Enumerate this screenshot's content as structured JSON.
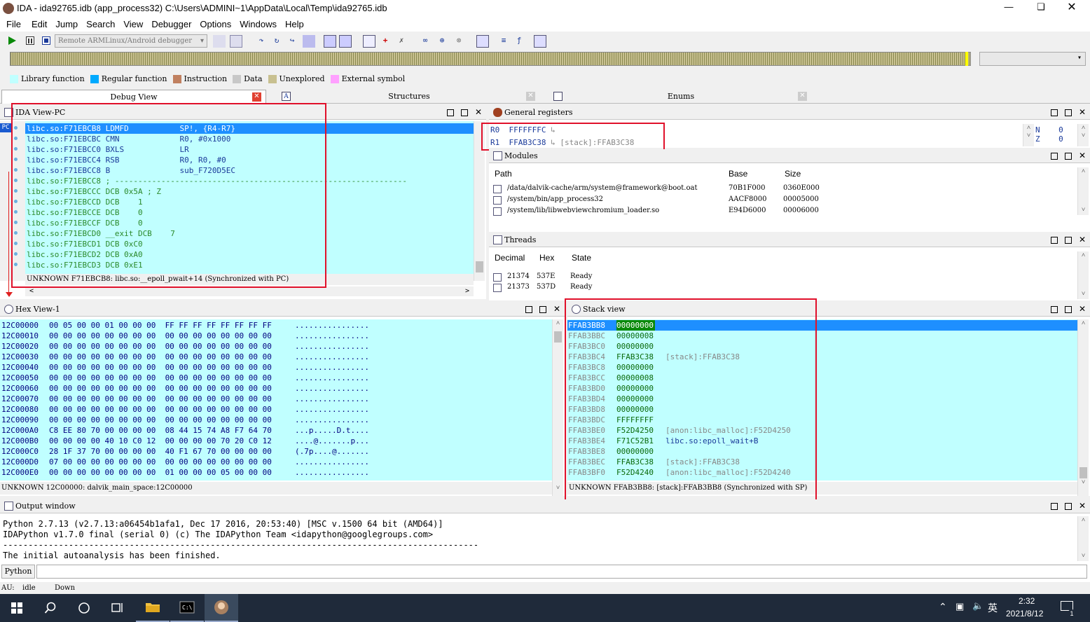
{
  "window": {
    "title": "IDA - ida92765.idb (app_process32) C:\\Users\\ADMINI~1\\AppData\\Local\\Temp\\ida92765.idb"
  },
  "menu": [
    "File",
    "Edit",
    "Jump",
    "Search",
    "View",
    "Debugger",
    "Options",
    "Windows",
    "Help"
  ],
  "toolbar": {
    "debugger_select": "Remote ARMLinux/Android debugger"
  },
  "legend": [
    {
      "label": "Library function",
      "color": "#c0ffff"
    },
    {
      "label": "Regular function",
      "color": "#00aaff"
    },
    {
      "label": "Instruction",
      "color": "#c08060"
    },
    {
      "label": "Data",
      "color": "#c8c8c8"
    },
    {
      "label": "Unexplored",
      "color": "#c8c090"
    },
    {
      "label": "External symbol",
      "color": "#ffa0ff"
    }
  ],
  "tabs": {
    "debug_view": "Debug View",
    "structures": "Structures",
    "enums": "Enums"
  },
  "ida_view": {
    "title": "IDA View-PC",
    "pc_label": "PC",
    "lines": [
      "libc.so:F71EBCB8 LDMFD           SP!, {R4-R7}",
      "libc.so:F71EBCBC CMN             R0, #0x1000",
      "libc.so:F71EBCC0 BXLS            LR",
      "libc.so:F71EBCC4 RSB             R0, R0, #0",
      "libc.so:F71EBCC8 B               sub_F720D5EC",
      "libc.so:F71EBCC8 ; ---------------------------------------------------------------",
      "libc.so:F71EBCCC DCB 0x5A ; Z",
      "libc.so:F71EBCCD DCB    1",
      "libc.so:F71EBCCE DCB    0",
      "libc.so:F71EBCCF DCB    0",
      "libc.so:F71EBCD0 __exit DCB    7",
      "libc.so:F71EBCD1 DCB 0xC0",
      "libc.so:F71EBCD2 DCB 0xA0",
      "libc.so:F71EBCD3 DCB 0xE1"
    ],
    "status": "UNKNOWN F71EBCB8: libc.so:__epoll_pwait+14 (Synchronized with PC)"
  },
  "registers": {
    "title": "General registers",
    "rows": [
      {
        "name": "R0",
        "value": "FFFFFFFC",
        "note": ""
      },
      {
        "name": "R1",
        "value": "FFAB3C38",
        "note": "[stack]:FFAB3C38"
      }
    ],
    "flags": [
      {
        "name": "N",
        "value": "0"
      },
      {
        "name": "Z",
        "value": "0"
      }
    ]
  },
  "modules": {
    "title": "Modules",
    "headers": [
      "Path",
      "Base",
      "Size"
    ],
    "rows": [
      [
        "/data/dalvik-cache/arm/system@framework@boot.oat",
        "70B1F000",
        "0360E000"
      ],
      [
        "/system/bin/app_process32",
        "AACF8000",
        "00005000"
      ],
      [
        "/system/lib/libwebviewchromium_loader.so",
        "E94D6000",
        "00006000"
      ]
    ]
  },
  "threads": {
    "title": "Threads",
    "headers": [
      "Decimal",
      "Hex",
      "State"
    ],
    "rows": [
      [
        "21374",
        "537E",
        "Ready"
      ],
      [
        "21373",
        "537D",
        "Ready"
      ]
    ]
  },
  "hex_view": {
    "title": "Hex View-1",
    "rows": [
      [
        "12C00000",
        "00 05 00 00 01 00 00 00  FF FF FF FF FF FF FF FF",
        "................"
      ],
      [
        "12C00010",
        "00 00 00 00 00 00 00 00  00 00 00 00 00 00 00 00",
        "................"
      ],
      [
        "12C00020",
        "00 00 00 00 00 00 00 00  00 00 00 00 00 00 00 00",
        "................"
      ],
      [
        "12C00030",
        "00 00 00 00 00 00 00 00  00 00 00 00 00 00 00 00",
        "................"
      ],
      [
        "12C00040",
        "00 00 00 00 00 00 00 00  00 00 00 00 00 00 00 00",
        "................"
      ],
      [
        "12C00050",
        "00 00 00 00 00 00 00 00  00 00 00 00 00 00 00 00",
        "................"
      ],
      [
        "12C00060",
        "00 00 00 00 00 00 00 00  00 00 00 00 00 00 00 00",
        "................"
      ],
      [
        "12C00070",
        "00 00 00 00 00 00 00 00  00 00 00 00 00 00 00 00",
        "................"
      ],
      [
        "12C00080",
        "00 00 00 00 00 00 00 00  00 00 00 00 00 00 00 00",
        "................"
      ],
      [
        "12C00090",
        "00 00 00 00 00 00 00 00  00 00 00 00 00 00 00 00",
        "................"
      ],
      [
        "12C000A0",
        "C8 EE 80 70 00 00 00 00  08 44 15 74 A8 F7 64 70",
        "...p.....D.t...."
      ],
      [
        "12C000B0",
        "00 00 00 00 40 10 C0 12  00 00 00 00 70 20 C0 12",
        "....@.......p..."
      ],
      [
        "12C000C0",
        "28 1F 37 70 00 00 00 00  40 F1 67 70 00 00 00 00",
        "(.7p....@......."
      ],
      [
        "12C000D0",
        "07 00 00 00 00 00 00 00  00 00 00 00 00 00 00 00",
        "................"
      ],
      [
        "12C000E0",
        "00 00 00 00 00 00 00 00  01 00 00 00 05 00 00 00",
        "................"
      ]
    ],
    "status": "UNKNOWN 12C00000: dalvik_main_space:12C00000"
  },
  "stack_view": {
    "title": "Stack view",
    "rows": [
      [
        "FFAB3BB8",
        "00000000",
        ""
      ],
      [
        "FFAB3BBC",
        "00000008",
        ""
      ],
      [
        "FFAB3BC0",
        "00000000",
        ""
      ],
      [
        "FFAB3BC4",
        "FFAB3C38",
        "[stack]:FFAB3C38"
      ],
      [
        "FFAB3BC8",
        "00000000",
        ""
      ],
      [
        "FFAB3BCC",
        "00000008",
        ""
      ],
      [
        "FFAB3BD0",
        "00000000",
        ""
      ],
      [
        "FFAB3BD4",
        "00000000",
        ""
      ],
      [
        "FFAB3BD8",
        "00000000",
        ""
      ],
      [
        "FFAB3BDC",
        "FFFFFFFF",
        ""
      ],
      [
        "FFAB3BE0",
        "F52D4250",
        "[anon:libc_malloc]:F52D4250"
      ],
      [
        "FFAB3BE4",
        "F71C52B1",
        "libc.so:epoll_wait+B"
      ],
      [
        "FFAB3BE8",
        "00000000",
        ""
      ],
      [
        "FFAB3BEC",
        "FFAB3C38",
        "[stack]:FFAB3C38"
      ],
      [
        "FFAB3BF0",
        "F52D4240",
        "[anon:libc_malloc]:F52D4240"
      ]
    ],
    "status": "UNKNOWN FFAB3BB8: [stack]:FFAB3BB8 (Synchronized with SP)"
  },
  "output": {
    "title": "Output window",
    "lines": [
      "Python 2.7.13 (v2.7.13:a06454b1afa1, Dec 17 2016, 20:53:40) [MSC v.1500 64 bit (AMD64)]",
      "IDAPython v1.7.0 final (serial 0) (c) The IDAPython Team <idapython@googlegroups.com>",
      "----------------------------------------------------------------------------------------------",
      "The initial autoanalysis has been finished."
    ],
    "python_label": "Python"
  },
  "statusbar": {
    "au": "AU:",
    "state": "idle",
    "direction": "Down"
  },
  "taskbar": {
    "time": "2:32",
    "date": "2021/8/12",
    "ime": "英",
    "notif_count": "1"
  }
}
